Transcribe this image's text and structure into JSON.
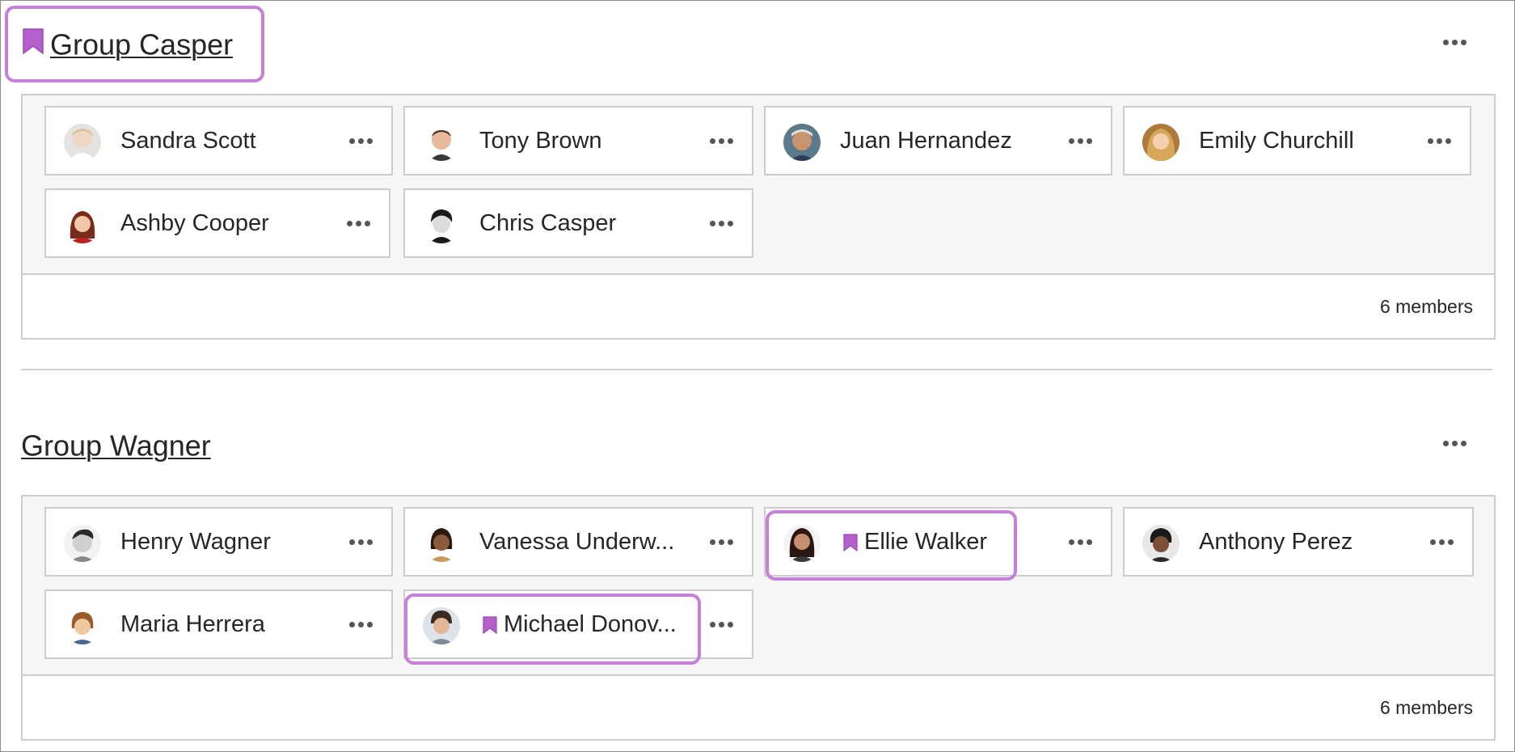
{
  "groups": [
    {
      "title": "Group Casper",
      "member_count": "6 members",
      "members": [
        {
          "name": "Sandra Scott"
        },
        {
          "name": "Tony Brown"
        },
        {
          "name": "Juan Hernandez"
        },
        {
          "name": "Emily Churchill"
        },
        {
          "name": "Ashby Cooper"
        },
        {
          "name": "Chris Casper"
        }
      ]
    },
    {
      "title": "Group Wagner",
      "member_count": "6 members",
      "members": [
        {
          "name": "Henry Wagner"
        },
        {
          "name": "Vanessa Underw..."
        },
        {
          "name": "Ellie Walker"
        },
        {
          "name": "Anthony Perez"
        },
        {
          "name": "Maria Herrera"
        },
        {
          "name": "Michael Donov..."
        }
      ]
    }
  ],
  "colors": {
    "highlight": "#c77fd9",
    "bookmark": "#b45fcc",
    "border": "#cdcdcd",
    "panel_bg": "#f6f6f6"
  },
  "icons": {
    "bookmark": "bookmark-icon",
    "more": "more-options-icon"
  }
}
